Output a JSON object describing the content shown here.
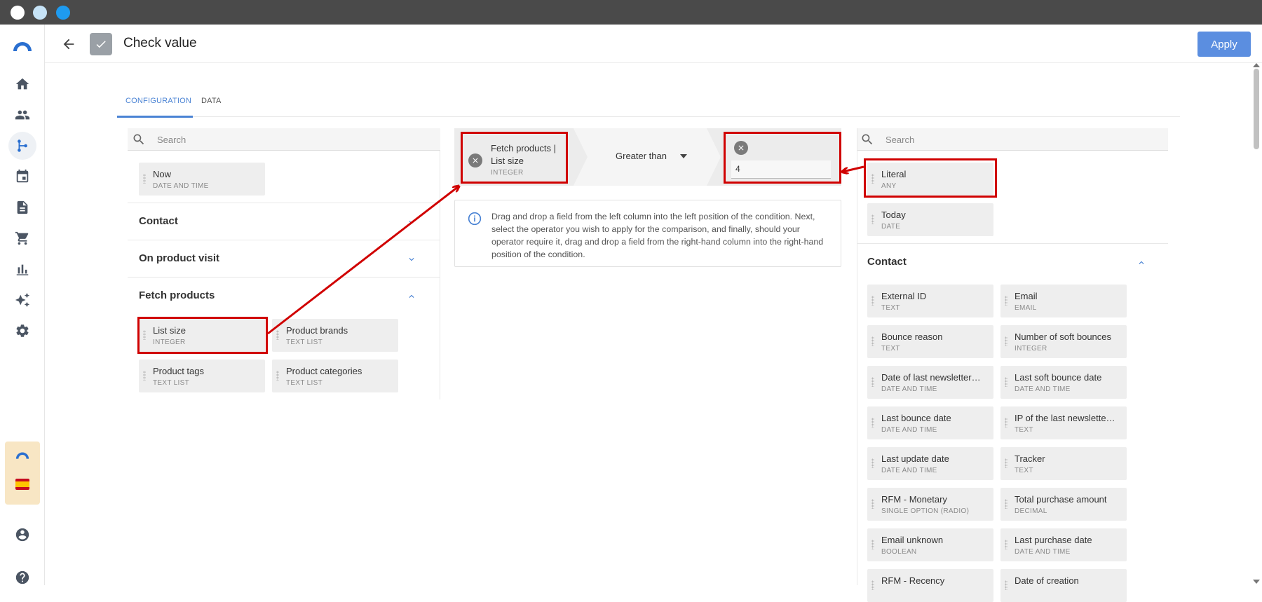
{
  "window": {
    "dot_colors": [
      "#ffffff",
      "#c6e3f7",
      "#1e9bf0"
    ]
  },
  "nav": {
    "items": [
      "home-icon",
      "contacts-icon",
      "workflow-icon",
      "calendar-icon",
      "document-icon",
      "cart-icon",
      "chart-icon",
      "sparkle-icon",
      "gear-icon"
    ],
    "bottom": [
      "account-icon",
      "help-icon"
    ],
    "active": "workflow-icon"
  },
  "header": {
    "title": "Check value",
    "apply_label": "Apply"
  },
  "tabs": [
    {
      "label": "CONFIGURATION",
      "active": true
    },
    {
      "label": "DATA",
      "active": false
    }
  ],
  "left_panel": {
    "search_placeholder": "Search",
    "now_chip": {
      "name": "Now",
      "type": "DATE AND TIME"
    },
    "sections": [
      {
        "title": "Contact",
        "expanded": false
      },
      {
        "title": "On product visit",
        "expanded": false
      },
      {
        "title": "Fetch products",
        "expanded": true
      }
    ],
    "fetch_products_fields": [
      {
        "name": "List size",
        "type": "INTEGER"
      },
      {
        "name": "Product brands",
        "type": "TEXT LIST"
      },
      {
        "name": "Product tags",
        "type": "TEXT LIST"
      },
      {
        "name": "Product categories",
        "type": "TEXT LIST"
      }
    ]
  },
  "condition": {
    "left_field": {
      "line1": "Fetch products |",
      "line2": "List size",
      "type": "INTEGER"
    },
    "operator": "Greater than",
    "right_value": "4"
  },
  "info": {
    "text": "Drag and drop a field from the left column into the left position of the condition. Next, select the operator you wish to apply for the comparison, and finally, should your operator require it, drag and drop a field from the right-hand column into the right-hand position of the condition."
  },
  "right_panel": {
    "search_placeholder": "Search",
    "top_chips": [
      {
        "name": "Literal",
        "type": "ANY"
      },
      {
        "name": "Today",
        "type": "DATE"
      }
    ],
    "contact_section_title": "Contact",
    "contact_fields": [
      {
        "name": "External ID",
        "type": "TEXT"
      },
      {
        "name": "Email",
        "type": "EMAIL"
      },
      {
        "name": "Bounce reason",
        "type": "TEXT"
      },
      {
        "name": "Number of soft bounces",
        "type": "INTEGER"
      },
      {
        "name": "Date of last newsletter…",
        "type": "DATE AND TIME"
      },
      {
        "name": "Last soft bounce date",
        "type": "DATE AND TIME"
      },
      {
        "name": "Last bounce date",
        "type": "DATE AND TIME"
      },
      {
        "name": "IP of the last newslette…",
        "type": "TEXT"
      },
      {
        "name": "Last update date",
        "type": "DATE AND TIME"
      },
      {
        "name": "Tracker",
        "type": "TEXT"
      },
      {
        "name": "RFM - Monetary",
        "type": "SINGLE OPTION (RADIO)"
      },
      {
        "name": "Total purchase amount",
        "type": "DECIMAL"
      },
      {
        "name": "Email unknown",
        "type": "BOOLEAN"
      },
      {
        "name": "Last purchase date",
        "type": "DATE AND TIME"
      },
      {
        "name": "RFM - Recency",
        "type": ""
      },
      {
        "name": "Date of creation",
        "type": ""
      }
    ]
  },
  "colors": {
    "accent": "#4a83d4",
    "apply_bg": "#5b8ee0",
    "annotation": "#d00000"
  }
}
